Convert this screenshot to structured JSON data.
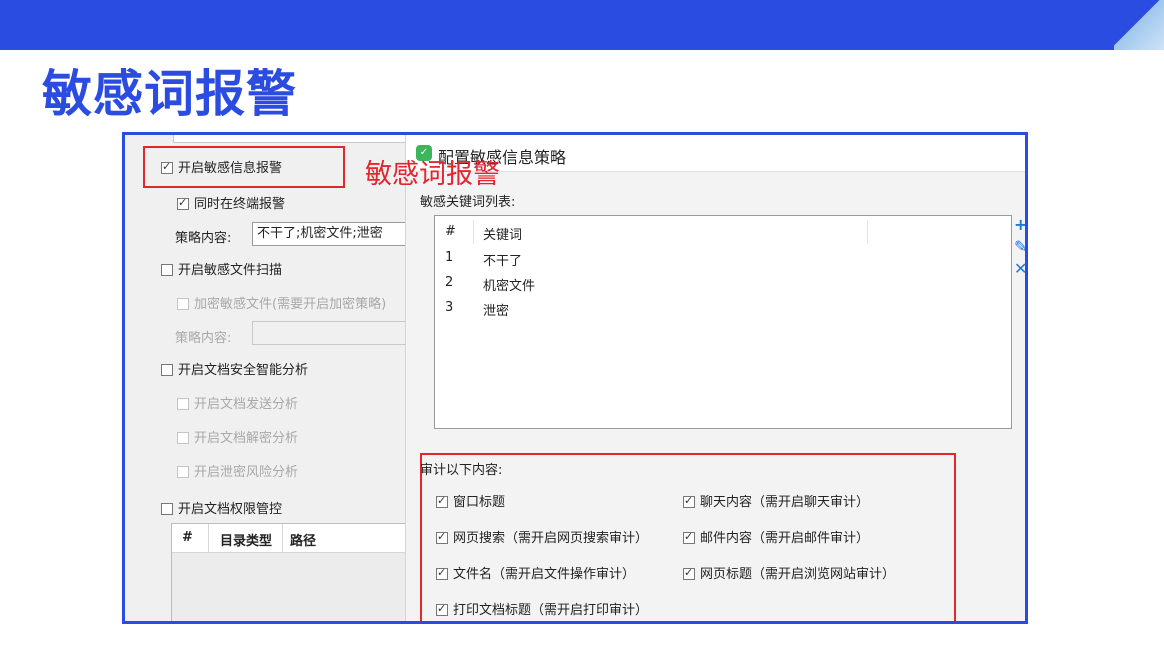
{
  "slide": {
    "title": "敏感词报警",
    "annotation": "敏感词报警"
  },
  "settings_panel": {
    "enable_alert": {
      "label": "开启敏感信息报警",
      "checked": true
    },
    "terminal_alert": {
      "label": "同时在终端报警",
      "checked": true
    },
    "policy_content_label": "策略内容:",
    "policy_content_value": "不干了;机密文件;泄密",
    "enable_file_scan": {
      "label": "开启敏感文件扫描",
      "checked": false
    },
    "encrypt_files": {
      "label": "加密敏感文件(需要开启加密策略)",
      "checked": false
    },
    "policy_content_label_2": "策略内容:",
    "policy_content_value_2": "",
    "enable_doc_analysis": {
      "label": "开启文档安全智能分析",
      "checked": false
    },
    "doc_send_analysis": {
      "label": "开启文档发送分析",
      "checked": false
    },
    "doc_decrypt_analysis": {
      "label": "开启文档解密分析",
      "checked": false
    },
    "leak_risk_analysis": {
      "label": "开启泄密风险分析",
      "checked": false
    },
    "enable_doc_permission": {
      "label": "开启文档权限管控",
      "checked": false
    },
    "dir_table": {
      "columns": [
        "#",
        "目录类型",
        "路径"
      ]
    }
  },
  "dialog": {
    "title": "配置敏感信息策略",
    "keyword_list_label": "敏感关键词列表:",
    "keyword_columns": [
      "#",
      "关键词"
    ],
    "keywords": [
      {
        "index": "1",
        "word": "不干了"
      },
      {
        "index": "2",
        "word": "机密文件"
      },
      {
        "index": "3",
        "word": "泄密"
      }
    ],
    "side_actions": [
      "add-icon",
      "edit-icon",
      "delete-icon"
    ],
    "audit_label": "审计以下内容:",
    "audit_items": [
      {
        "label": "窗口标题",
        "checked": true
      },
      {
        "label": "聊天内容（需开启聊天审计）",
        "checked": true
      },
      {
        "label": "网页搜索（需开启网页搜索审计）",
        "checked": true
      },
      {
        "label": "邮件内容（需开启邮件审计）",
        "checked": true
      },
      {
        "label": "文件名（需开启文件操作审计）",
        "checked": true
      },
      {
        "label": "网页标题（需开启浏览网站审计）",
        "checked": true
      },
      {
        "label": "打印文档标题（需开启打印审计）",
        "checked": true
      }
    ]
  },
  "colors": {
    "brand": "#2b4ce0",
    "highlight": "#e0262f",
    "icon_accent": "#1e78d6"
  }
}
